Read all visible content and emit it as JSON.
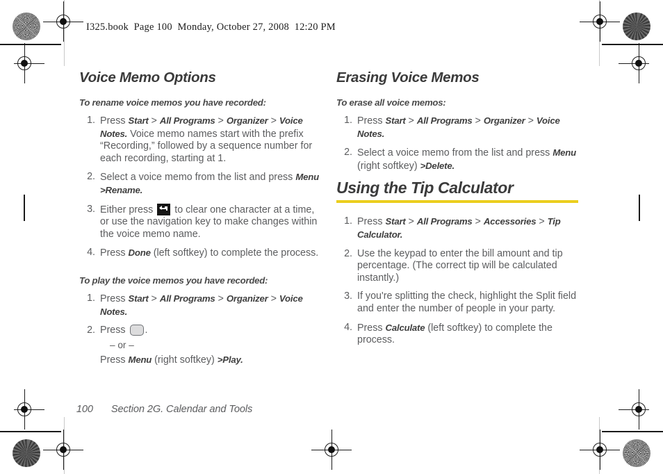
{
  "running_header": "I325.book  Page 100  Monday, October 27, 2008  12:20 PM",
  "colors": {
    "accent_rule": "#EBCE1E",
    "body_text": "#5C5D5F",
    "heading_text": "#3B3B3B"
  },
  "left_column": {
    "heading": "Voice Memo Options",
    "section_1": {
      "lead": "To rename voice memos you have recorded:",
      "steps": [
        {
          "num": "1.",
          "press_label": "Press",
          "path": [
            "Start",
            "All Programs",
            "Organizer",
            "Voice Notes"
          ],
          "trailing": "Voice memo names start with the prefix “Recording,” followed by a sequence number for each recording, starting at 1."
        },
        {
          "num": "2.",
          "text_before": "Select a voice memo from the list and press",
          "term1": "Menu",
          "sep": ">",
          "term2": "Rename",
          "period": "."
        },
        {
          "num": "3.",
          "text_before": "Either press",
          "icon": "back-key-icon",
          "text_after": "to clear one character at a time, or use the navigation key to make changes within the voice memo name."
        },
        {
          "num": "4.",
          "text_before": "Press",
          "term1": "Done",
          "text_after": "(left softkey) to complete the process."
        }
      ]
    },
    "section_2": {
      "lead": "To play the voice memos you have recorded:",
      "steps": [
        {
          "num": "1.",
          "press_label": "Press",
          "path": [
            "Start",
            "All Programs",
            "Organizer",
            "Voice Notes"
          ],
          "period": "."
        },
        {
          "num": "2.",
          "text_before": "Press",
          "icon": "center-key-icon",
          "period": ".",
          "or_text": "– or –",
          "alt_before": "Press",
          "alt_term": "Menu",
          "alt_middle": "(right softkey)",
          "alt_sep": ">",
          "alt_term2": "Play",
          "alt_period": "."
        }
      ]
    }
  },
  "right_column": {
    "heading": "Erasing Voice Memos",
    "section_1": {
      "lead": "To erase all voice memos:",
      "steps": [
        {
          "num": "1.",
          "press_label": "Press",
          "path": [
            "Start",
            "All Programs",
            "Organizer",
            "Voice Notes"
          ],
          "period": "."
        },
        {
          "num": "2.",
          "text_before": "Select a voice memo from the list and press",
          "term1": "Menu",
          "text_middle": "(right softkey)",
          "sep": ">",
          "term2": "Delete",
          "period": "."
        }
      ]
    },
    "major_heading": "Using the Tip Calculator",
    "section_2": {
      "steps": [
        {
          "num": "1.",
          "press_label": "Press",
          "path": [
            "Start",
            "All Programs",
            "Accessories",
            "Tip Calculator"
          ],
          "period": "."
        },
        {
          "num": "2.",
          "text": "Use the keypad to enter the bill amount and tip percentage. (The correct tip will be calculated instantly.)"
        },
        {
          "num": "3.",
          "text": "If you're splitting the check, highlight the Split field and enter the number of people in your party."
        },
        {
          "num": "4.",
          "text_before": "Press",
          "term1": "Calculate",
          "text_after": "(left softkey) to complete the process."
        }
      ]
    }
  },
  "footer": {
    "page_number": "100",
    "section_title": "Section 2G. Calendar and Tools"
  }
}
